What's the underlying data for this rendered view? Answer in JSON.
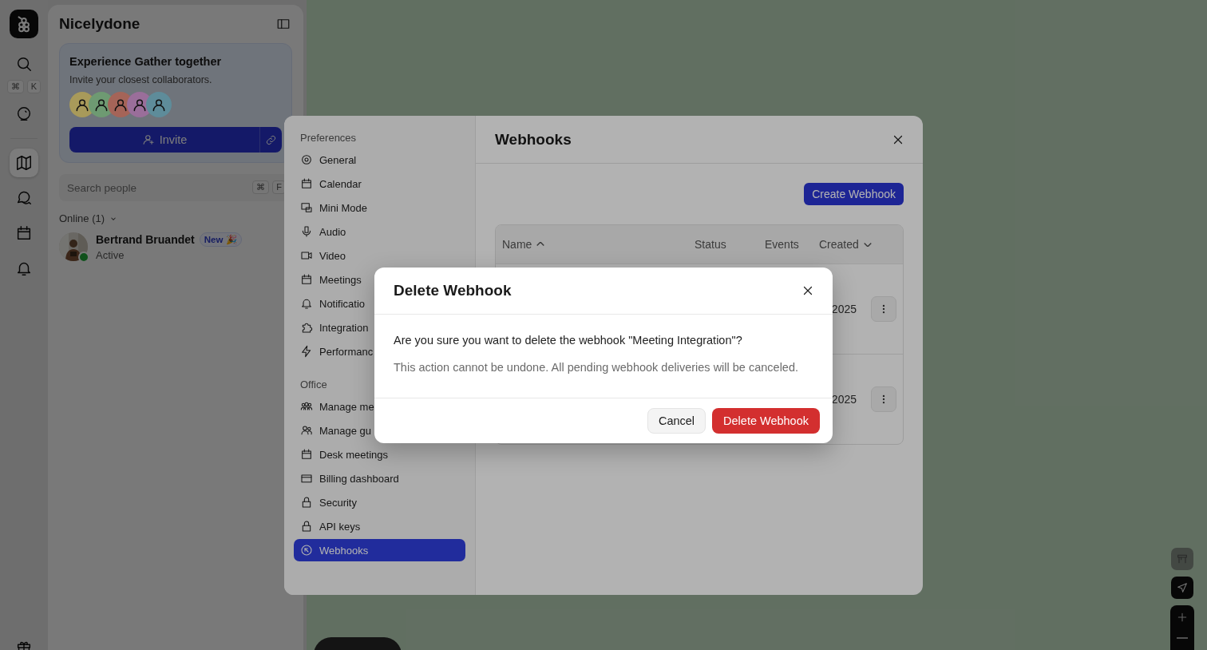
{
  "app": {
    "name": "Nicelydone"
  },
  "rail": {
    "shortcut_keys": [
      "⌘",
      "K"
    ],
    "items": [
      {
        "kind": "search",
        "selected": false
      },
      {
        "kind": "orb",
        "selected": false
      },
      {
        "kind": "map",
        "selected": true
      },
      {
        "kind": "chat",
        "selected": false
      },
      {
        "kind": "calendar",
        "selected": false
      },
      {
        "kind": "bell",
        "selected": false
      }
    ],
    "bottom_items": [
      {
        "kind": "gift",
        "selected": false
      }
    ]
  },
  "invite_card": {
    "title": "Experience Gather together",
    "subtitle": "Invite your closest collaborators.",
    "avatars": [
      {
        "color": "#a89a5a"
      },
      {
        "color": "#6e9a72"
      },
      {
        "color": "#a56458"
      },
      {
        "color": "#9a6e9a"
      },
      {
        "color": "#5e8c9a"
      }
    ],
    "button": "Invite"
  },
  "search": {
    "placeholder": "Search people",
    "shortcut_keys": [
      "⌘",
      "F"
    ]
  },
  "online": {
    "label": "Online (1)",
    "expanded": true,
    "members": [
      {
        "name": "Bertrand Bruandet",
        "badge": "New 🎉",
        "status": "Active",
        "online": true
      }
    ]
  },
  "settings": {
    "sections": [
      {
        "title": "Preferences",
        "items": [
          {
            "label": "General",
            "kind": "gear",
            "selected": false
          },
          {
            "label": "Calendar",
            "kind": "calendar",
            "selected": false
          },
          {
            "label": "Mini Mode",
            "kind": "minimode",
            "selected": false
          },
          {
            "label": "Audio",
            "kind": "mic",
            "selected": false
          },
          {
            "label": "Video",
            "kind": "video",
            "selected": false
          },
          {
            "label": "Meetings",
            "kind": "calendar",
            "selected": false
          },
          {
            "label": "Notificatio",
            "kind": "bell",
            "selected": false
          },
          {
            "label": "Integration",
            "kind": "puzzle",
            "selected": false
          },
          {
            "label": "Performanc",
            "kind": "bolt",
            "selected": false
          }
        ]
      },
      {
        "title": "Office",
        "items": [
          {
            "label": "Manage me",
            "kind": "users3",
            "selected": false
          },
          {
            "label": "Manage gu",
            "kind": "users2",
            "selected": false
          },
          {
            "label": "Desk meetings",
            "kind": "calendar",
            "selected": false
          },
          {
            "label": "Billing dashboard",
            "kind": "card",
            "selected": false
          },
          {
            "label": "Security",
            "kind": "lock",
            "selected": false
          },
          {
            "label": "API keys",
            "kind": "lock",
            "selected": false
          },
          {
            "label": "Webhooks",
            "kind": "webhook",
            "selected": true
          }
        ]
      }
    ],
    "panel": {
      "title": "Webhooks",
      "create_button": "Create Webhook",
      "columns": [
        {
          "label": "Name",
          "kind": "sort-asc"
        },
        {
          "label": "Status",
          "kind": "plain"
        },
        {
          "label": "Events",
          "kind": "plain"
        },
        {
          "label": "Created",
          "kind": "sort-desc"
        }
      ],
      "rows": [
        {
          "created": "2025"
        },
        {
          "created": "2025"
        }
      ]
    }
  },
  "dialog": {
    "title": "Delete Webhook",
    "question": "Are you sure you want to delete the webhook \"Meeting Integration\"?",
    "note": "This action cannot be undone. All pending webhook deliveries will be canceled.",
    "cancel": "Cancel",
    "confirm": "Delete Webhook"
  }
}
